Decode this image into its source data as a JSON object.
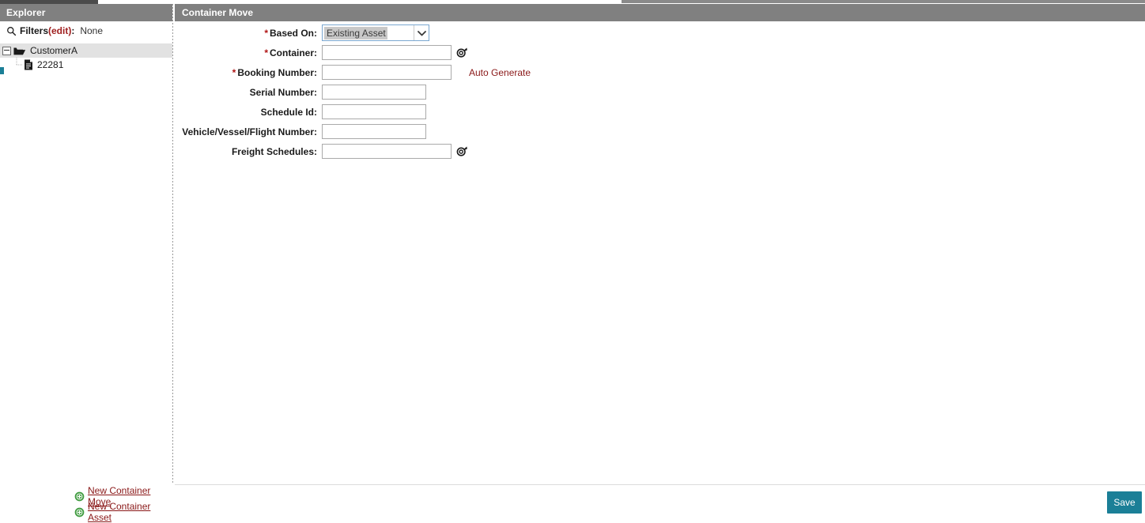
{
  "colors": {
    "header_bar": "#808080",
    "accent_teal": "#1b7f97",
    "link_red": "#8a1818",
    "required_star": "#b01515",
    "selection_gray": "#c8c8c8"
  },
  "explorer": {
    "title": "Explorer",
    "filters": {
      "search_icon": "search-icon",
      "label": "Filters ",
      "edit_label": "(edit)",
      "colon": ":",
      "value": "None"
    },
    "tree": [
      {
        "icon": "open-folder-icon",
        "label": "CustomerA",
        "selected": true,
        "toggle": "collapse-toggle"
      },
      {
        "icon": "document-icon",
        "label": "22281",
        "selected": false
      }
    ],
    "actions": [
      {
        "icon": "add-circle-icon",
        "label": "New Container Move"
      },
      {
        "icon": "add-circle-icon",
        "label": "New Container Asset"
      }
    ]
  },
  "main": {
    "title": "Container Move",
    "fields": [
      {
        "label": "Based On:",
        "required": true,
        "type": "select",
        "value": "Existing Asset"
      },
      {
        "label": "Container:",
        "required": true,
        "type": "text",
        "value": "",
        "placeholder": "",
        "size": "wide",
        "lookup": "lookup-search-icon"
      },
      {
        "label": "Booking Number:",
        "required": true,
        "type": "text",
        "value": "",
        "placeholder": "",
        "size": "wide",
        "side_link": "Auto Generate"
      },
      {
        "label": "Serial Number:",
        "required": false,
        "type": "text",
        "value": "",
        "placeholder": "",
        "size": "narrow"
      },
      {
        "label": "Schedule Id:",
        "required": false,
        "type": "text",
        "value": "",
        "placeholder": "",
        "size": "narrow"
      },
      {
        "label": "Vehicle/Vessel/Flight Number:",
        "required": false,
        "type": "text",
        "value": "",
        "placeholder": "",
        "size": "narrow"
      },
      {
        "label": "Freight Schedules:",
        "required": false,
        "type": "text",
        "value": "",
        "placeholder": "",
        "size": "wide",
        "lookup": "lookup-search-icon"
      }
    ]
  },
  "footer": {
    "save_label": "Save"
  }
}
